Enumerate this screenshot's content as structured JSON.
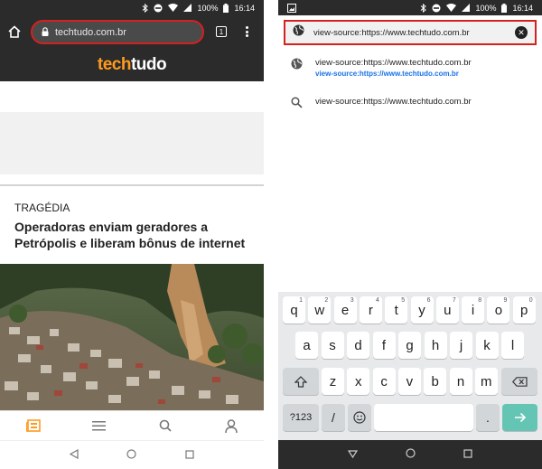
{
  "status": {
    "battery": "100%",
    "time": "16:14"
  },
  "left": {
    "url": "techtudo.com.br",
    "tab_count": "1",
    "brand_part1": "tech",
    "brand_part2": "tudo",
    "article": {
      "kicker": "TRAGÉDIA",
      "headline": "Operadoras enviam geradores a Petrópolis e liberam bônus de internet"
    }
  },
  "right": {
    "omnibox_text": "view-source:https://www.techtudo.com.br",
    "suggestions": [
      {
        "icon": "globe-icon",
        "text": "view-source:https://www.techtudo.com.br",
        "sub": "view-source:https://www.techtudo.com.br"
      },
      {
        "icon": "search-icon",
        "text": "view-source:https://www.techtudo.com.br"
      }
    ],
    "keyboard": {
      "row1": [
        {
          "k": "q",
          "n": "1"
        },
        {
          "k": "w",
          "n": "2"
        },
        {
          "k": "e",
          "n": "3"
        },
        {
          "k": "r",
          "n": "4"
        },
        {
          "k": "t",
          "n": "5"
        },
        {
          "k": "y",
          "n": "6"
        },
        {
          "k": "u",
          "n": "7"
        },
        {
          "k": "i",
          "n": "8"
        },
        {
          "k": "o",
          "n": "9"
        },
        {
          "k": "p",
          "n": "0"
        }
      ],
      "row2": [
        "a",
        "s",
        "d",
        "f",
        "g",
        "h",
        "j",
        "k",
        "l"
      ],
      "row3": [
        "z",
        "x",
        "c",
        "v",
        "b",
        "n",
        "m"
      ],
      "sym_label": "?123",
      "slash": "/",
      "period": "."
    }
  },
  "colors": {
    "accent_red": "#d62020",
    "brand_orange": "#ff9a1f",
    "enter_teal": "#65c5b5",
    "link_blue": "#1a73e8"
  }
}
